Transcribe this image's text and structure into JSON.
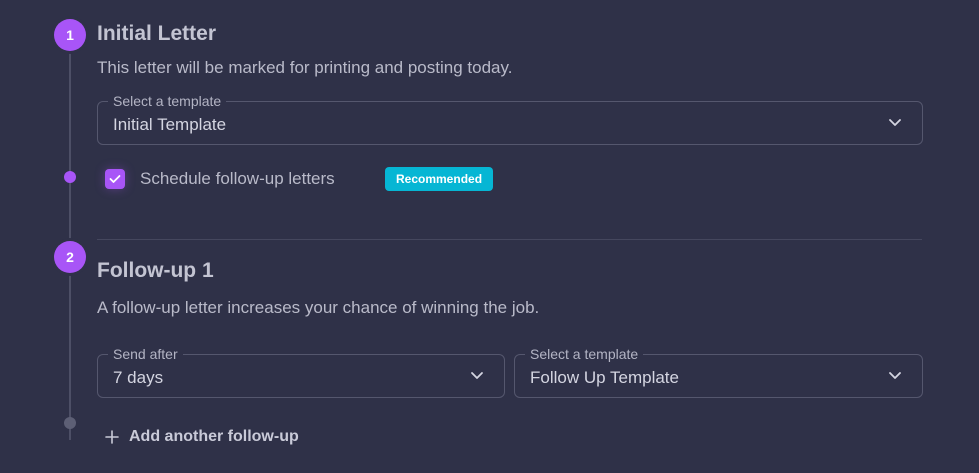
{
  "steps": [
    {
      "number": "1",
      "title": "Initial Letter",
      "description": "This letter will be marked for printing and posting today.",
      "template": {
        "label": "Select a template",
        "value": "Initial Template"
      },
      "follow_up": {
        "label": "Schedule follow-up letters",
        "checked": true,
        "badge": "Recommended"
      }
    },
    {
      "number": "2",
      "title": "Follow-up 1",
      "description": "A follow-up letter increases your chance of winning the job.",
      "send_after": {
        "label": "Send after",
        "value": "7 days"
      },
      "template": {
        "label": "Select a template",
        "value": "Follow Up Template"
      }
    }
  ],
  "add_follow_up": {
    "label": "Add another follow-up"
  },
  "colors": {
    "background": "#2f3148",
    "accent": "#a855f7",
    "badge": "#06b6d4"
  }
}
